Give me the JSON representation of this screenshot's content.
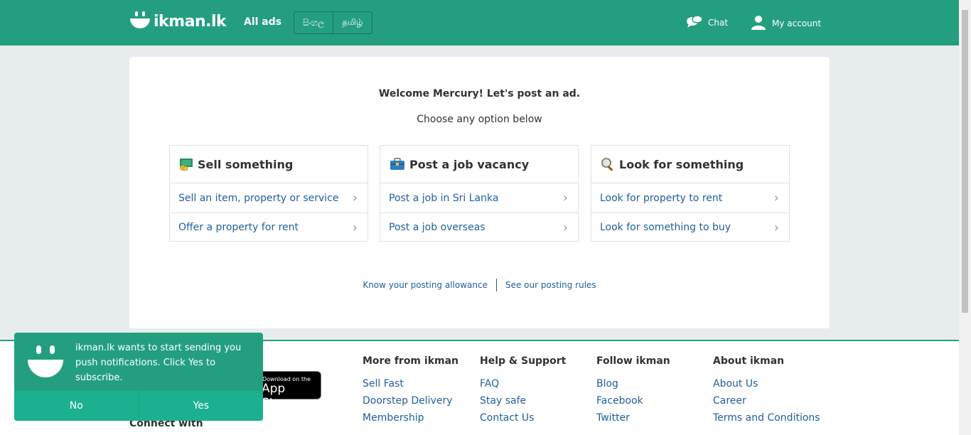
{
  "header": {
    "logo_text": "ikman.lk",
    "all_ads": "All ads",
    "languages": [
      "සිංහල",
      "தமிழ்"
    ],
    "chat": "Chat",
    "account": "My account"
  },
  "main": {
    "welcome": "Welcome Mercury! Let's post an ad.",
    "choose": "Choose any option below",
    "boxes": [
      {
        "title": "Sell something",
        "icon": "money-icon",
        "items": [
          "Sell an item, property or service",
          "Offer a property for rent"
        ]
      },
      {
        "title": "Post a job vacancy",
        "icon": "briefcase-icon",
        "items": [
          "Post a job in Sri Lanka",
          "Post a job overseas"
        ]
      },
      {
        "title": "Look for something",
        "icon": "magnifier-icon",
        "items": [
          "Look for property to rent",
          "Look for something to buy"
        ]
      }
    ],
    "links": [
      "Know your posting allowance",
      "See our posting rules"
    ]
  },
  "footer": {
    "appstore_small": "Download on the",
    "appstore_big": "App Store",
    "connect": "Connect with",
    "columns": [
      {
        "title": "More from ikman",
        "items": [
          "Sell Fast",
          "Doorstep Delivery",
          "Membership"
        ]
      },
      {
        "title": "Help & Support",
        "items": [
          "FAQ",
          "Stay safe",
          "Contact Us"
        ]
      },
      {
        "title": "Follow ikman",
        "items": [
          "Blog",
          "Facebook",
          "Twitter"
        ]
      },
      {
        "title": "About ikman",
        "items": [
          "About Us",
          "Career",
          "Terms and Conditions"
        ]
      }
    ]
  },
  "notification": {
    "text": "ikman.lk wants to start sending you push notifications. Click Yes to subscribe.",
    "no": "No",
    "yes": "Yes"
  },
  "colors": {
    "brand": "#239f80",
    "link": "#1f5f9e"
  }
}
